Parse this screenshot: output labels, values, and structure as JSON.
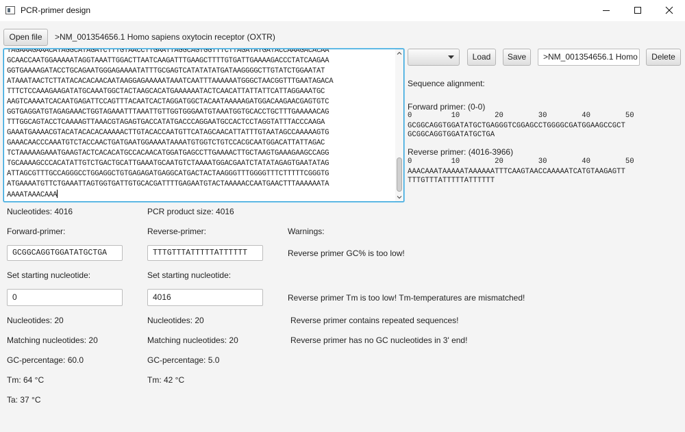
{
  "window": {
    "title": "PCR-primer design"
  },
  "toolbar": {
    "open_file_label": "Open file",
    "sequence_header": ">NM_001354656.1 Homo sapiens oxytocin receptor (OXTR)"
  },
  "sequence": {
    "lines": [
      "TAGAAAGAAACATAGGCATAGATCTTTGTAACCTTGAATTAGGCAGTGGTTTCTTAGATATGATACCAAAGACACAA",
      "GCAACCAATGGAAAAATAGGTAAATTGGACTTAATCAAGATTTGAAGCTTTTGTGATTGAAAAGACCCTATCAAGAA",
      "GGTGAAAAGATACCTGCAGAATGGGAGAAAATATTTGCGAGTCATATATATGATAAGGGGCTTGTATCTGGAATAT",
      "ATAAATAACTCTTATACACACAACAATAAGGAGAAAAATAAATCAATTTAAAAAATGGGCTAACGGTTTGAATAGACA",
      "TTTCTCCAAAGAAGATATGCAAATGGCTACTAAGCACATGAAAAAATACTCAACATTATTATTCATTAGGAAATGC",
      "AAGTCAAAATCACAATGAGATTCCAGTTTACAATCACTAGGATGGCTACAATAAAAAGATGGACAAGAACGAGTGTC",
      "GGTGAGGATGTAGAGAAACTGGTAGAAATTTAAATTGTTGGTGGGAATGTAAATGGTGCACCTGCTTTGAAAAACAG",
      "TTTGGCAGTACCTCAAAAGTTAAACGTAGAGTGACCATATGACCCAGGAATGCCACTCCTAGGTATTTACCCAAGA",
      "GAAATGAAAACGTACATACACACAAAAACTTGTACACCAATGTTCATAGCAACATTATTTGTAATAGCCAAAAAGTG",
      "GAAACAACCCAAATGTCTACCAACTGATGAATGGAAAATAAAATGTGGTCTGTCCACGCAATGGACATTATTAGAC",
      "TCTAAAAAGAAATGAAGTACTCACACATGCCACAACATGGATGAGCCTTGAAAACTTGCTAAGTGAAAGAAGCCAGG",
      "TGCAAAAGCCCACATATTGTCTGACTGCATTGAAATGCAATGTCTAAAATGGACGAATCTATATAGAGTGAATATAG",
      "ATTAGCGTTTGCCAGGGCCTGGAGGCTGTGAGAGATGAGGCATGACTACTAAGGGTTTGGGGTTTCTTTTTCGGGTG",
      "ATGAAAATGTTCTGAAATTAGTGGTGATTGTGCACGATTTTGAGAATGTACTAAAAACCAATGAACTTTAAAAAATA",
      "AAAATAAACAAA"
    ]
  },
  "right_toolbar": {
    "load_label": "Load",
    "save_label": "Save",
    "header_field_value": ">NM_001354656.1 Homo",
    "delete_label": "Delete"
  },
  "alignment": {
    "title": "Sequence alignment:",
    "forward_title": "Forward primer: (0-0)",
    "forward_ruler": "0         10        20        30        40        50",
    "forward_seq": "GCGGCAGGTGGATATGCTGAGGGTCGGAGCCTGGGGCGATGGAAGCCGCT",
    "forward_primer_line": "GCGGCAGGTGGATATGCTGA",
    "reverse_title": "Reverse primer: (4016-3966)",
    "reverse_ruler": "0         10        20        30        40        50",
    "reverse_seq": "AAACAAATAAAAATAAAAAATTTCAAGTAACCAAAAATCATGTAAGAGTT",
    "reverse_primer_line": "TTTGTTTATTTTTATTTTTT"
  },
  "stats": {
    "nucleotides": "Nucleotides: 4016",
    "pcr_product": "PCR product size: 4016"
  },
  "forward": {
    "title": "Forward-primer:",
    "primer_value": "GCGGCAGGTGGATATGCTGA",
    "start_label": "Set starting nucleotide:",
    "start_value": "0",
    "nucleotides": "Nucleotides: 20",
    "matching": "Matching nucleotides: 20",
    "gc": "GC-percentage: 60.0",
    "tm": "Tm: 64 °C",
    "ta": "Ta: 37 °C"
  },
  "reverse": {
    "title": "Reverse-primer:",
    "primer_value": "TTTGTTTATTTTTATTTTTT",
    "start_label": "Set starting nucleotide:",
    "start_value": "4016",
    "nucleotides": "Nucleotides: 20",
    "matching": "Matching nucleotides: 20",
    "gc": "GC-percentage: 5.0",
    "tm": "Tm: 42 °C"
  },
  "warnings": {
    "title": "Warnings:",
    "items": [
      "Reverse primer GC% is too low!",
      "Reverse primer Tm is too low!  Tm-temperatures are mismatched!",
      "Reverse primer contains repeated sequences!",
      "Reverse primer has no GC nucleotides in 3' end!"
    ]
  }
}
